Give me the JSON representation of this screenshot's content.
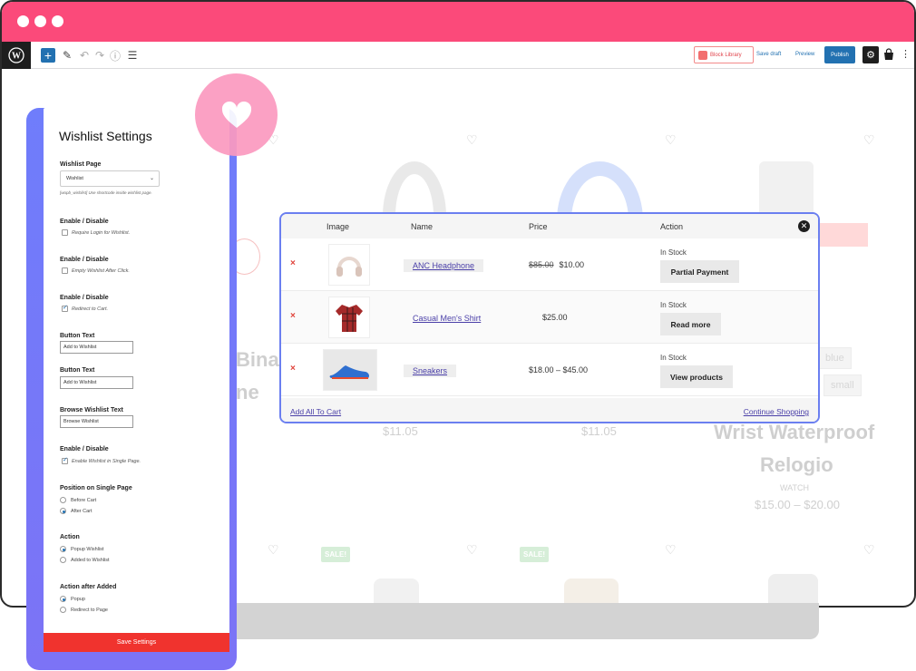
{
  "colors": {
    "titlebar": "#fb4a7a",
    "accent": "#2271b1",
    "panel_gradient": "#6f7dfb",
    "save_button": "#f0332e",
    "modal_border": "#6b7ff0",
    "heart_badge": "#fb9ac0"
  },
  "toolbar": {
    "block_library_label": "Block Library",
    "save_draft_label": "Save draft",
    "preview_label": "Preview",
    "publish_label": "Publish"
  },
  "background_shop": {
    "partial_titles": [
      "Bina",
      "ne"
    ],
    "prices": [
      "$11.05",
      "$11.05"
    ],
    "product_title_line1": "Wrist Waterproof",
    "product_title_line2": "Relogio",
    "product_category": "WATCH",
    "product_price": "$15.00 – $20.00",
    "tags": [
      "blue",
      "small"
    ],
    "sale_badges": [
      "SALE!",
      "SALE!"
    ]
  },
  "modal": {
    "columns": [
      "Image",
      "Name",
      "Price",
      "Action"
    ],
    "rows": [
      {
        "name": "ANC Headphone",
        "old_price": "$85.00",
        "price": "$10.00",
        "stock": "In Stock",
        "action": "Partial Payment",
        "thumb_icon": "headphone-icon"
      },
      {
        "name": "Casual Men's Shirt",
        "old_price": "",
        "price": "$25.00",
        "stock": "In Stock",
        "action": "Read more",
        "thumb_icon": "shirt-icon"
      },
      {
        "name": "Sneakers",
        "old_price": "",
        "price": "$18.00 – $45.00",
        "stock": "In Stock",
        "action": "View products",
        "thumb_icon": "sneaker-icon"
      }
    ],
    "add_all_label": "Add All To Cart",
    "continue_label": "Continue Shopping"
  },
  "settings": {
    "title": "Wishlist Settings",
    "wishlist_page_label": "Wishlist Page",
    "wishlist_page_value": "Wishlist",
    "shortcode_hint": "[wopb_wishlist] Use shortcode inside wishlist page.",
    "require_login": {
      "label": "Enable / Disable",
      "option": "Require Login for Wishlist.",
      "checked": false
    },
    "empty_wishlist": {
      "label": "Enable / Disable",
      "option": "Empty Wishlist After Click.",
      "checked": false
    },
    "redirect_cart": {
      "label": "Enable / Disable",
      "option": "Redirect to Cart.",
      "checked": true
    },
    "button_text_1": {
      "label": "Button Text",
      "value": "Add to Wishlist"
    },
    "button_text_2": {
      "label": "Button Text",
      "value": "Add to Wishlist"
    },
    "browse_text": {
      "label": "Browse Wishlist Text",
      "value": "Browse Wishlist"
    },
    "single_page": {
      "label": "Enable / Disable",
      "option": "Enable Wishlist in Single Page.",
      "checked": true
    },
    "position": {
      "label": "Position on Single Page",
      "options": [
        "Before Cart",
        "After Cart"
      ],
      "selected": "After Cart"
    },
    "action": {
      "label": "Action",
      "options": [
        "Popup Wishlist",
        "Added to Wishlist"
      ],
      "selected": "Popup Wishlist"
    },
    "action_after": {
      "label": "Action after Added",
      "options": [
        "Popup",
        "Redirect to Page"
      ],
      "selected": "Popup"
    },
    "save_label": "Save Settings"
  }
}
